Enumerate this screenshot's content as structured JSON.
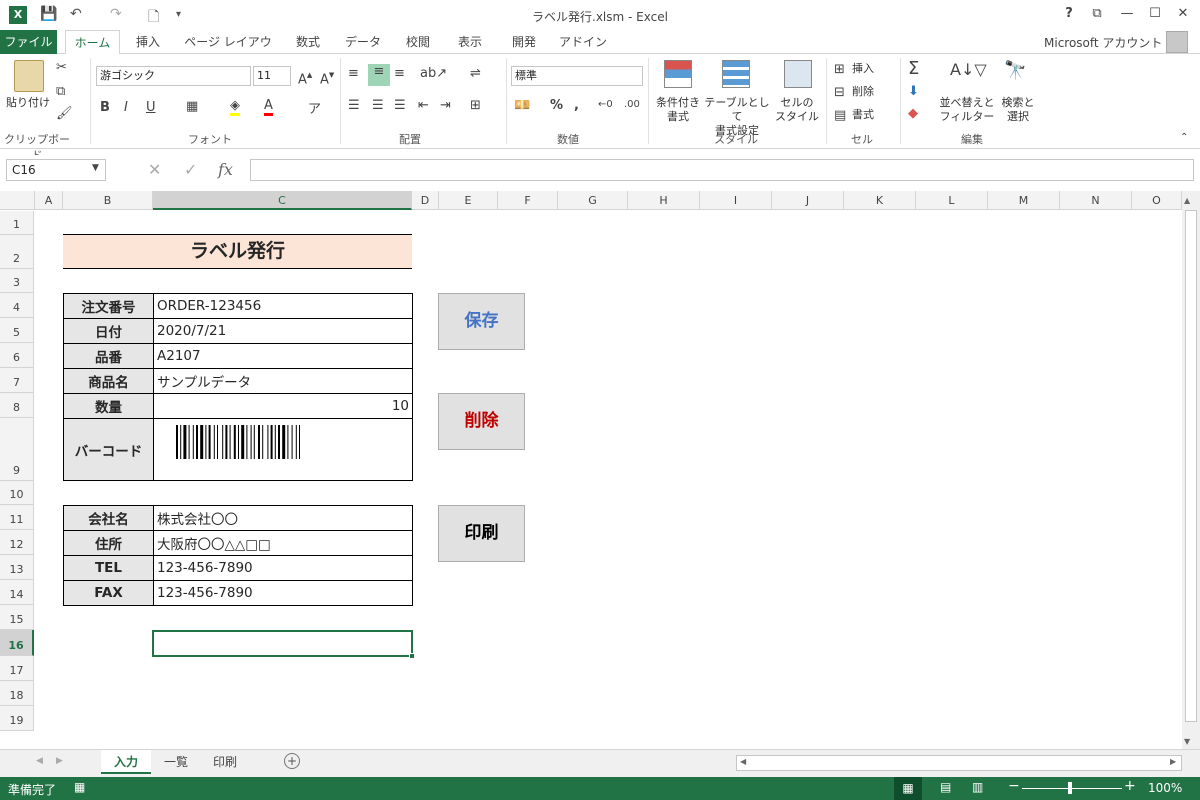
{
  "window": {
    "title": "ラベル発行.xlsm - Excel",
    "account": "Microsoft アカウント",
    "help": "?"
  },
  "ribbon": {
    "tabs": [
      "ファイル",
      "ホーム",
      "挿入",
      "ページ レイアウト",
      "数式",
      "データ",
      "校閲",
      "表示",
      "開発",
      "アドイン"
    ],
    "clipboard": {
      "paste_label": "貼り付け",
      "group": "クリップボード"
    },
    "font": {
      "name": "游ゴシック",
      "size": "11",
      "group": "フォント"
    },
    "alignment": {
      "group": "配置"
    },
    "number": {
      "format": "標準",
      "group": "数値"
    },
    "styles": {
      "cond_format": "条件付き\n書式",
      "table_format": "テーブルとして\n書式設定",
      "cell_styles": "セルの\nスタイル",
      "group": "スタイル"
    },
    "cells": {
      "insert": "挿入",
      "delete": "削除",
      "format": "書式",
      "group": "セル"
    },
    "editing": {
      "sort_filter": "並べ替えと\nフィルター",
      "find_select": "検索と\n選択",
      "group": "編集"
    }
  },
  "formula_bar": {
    "name_box": "C16",
    "fx": "fx",
    "value": ""
  },
  "columns": [
    "A",
    "B",
    "C",
    "D",
    "E",
    "F",
    "G",
    "H",
    "I",
    "J",
    "K",
    "L",
    "M",
    "N",
    "O"
  ],
  "rows": [
    "1",
    "2",
    "3",
    "4",
    "5",
    "6",
    "7",
    "8",
    "9",
    "10",
    "11",
    "12",
    "13",
    "14",
    "15",
    "16",
    "17",
    "18",
    "19"
  ],
  "sheet": {
    "title": "ラベル発行",
    "order_table": [
      {
        "label": "注文番号",
        "value": "ORDER-123456"
      },
      {
        "label": "日付",
        "value": "2020/7/21"
      },
      {
        "label": "品番",
        "value": "A2107"
      },
      {
        "label": "商品名",
        "value": "サンプルデータ"
      },
      {
        "label": "数量",
        "value": "10"
      },
      {
        "label": "バーコード",
        "value": ""
      }
    ],
    "company_table": [
      {
        "label": "会社名",
        "value": "株式会社〇〇"
      },
      {
        "label": "住所",
        "value": "大阪府〇〇△△□□"
      },
      {
        "label": "TEL",
        "value": "123-456-7890"
      },
      {
        "label": "FAX",
        "value": "123-456-7890"
      }
    ],
    "buttons": {
      "save": "保存",
      "delete": "削除",
      "print": "印刷"
    },
    "colors": {
      "save": "#4472c4",
      "delete": "#c00000",
      "print": "#000000"
    }
  },
  "sheet_tabs": [
    "入力",
    "一覧",
    "印刷"
  ],
  "status": {
    "ready": "準備完了",
    "zoom": "100%"
  }
}
